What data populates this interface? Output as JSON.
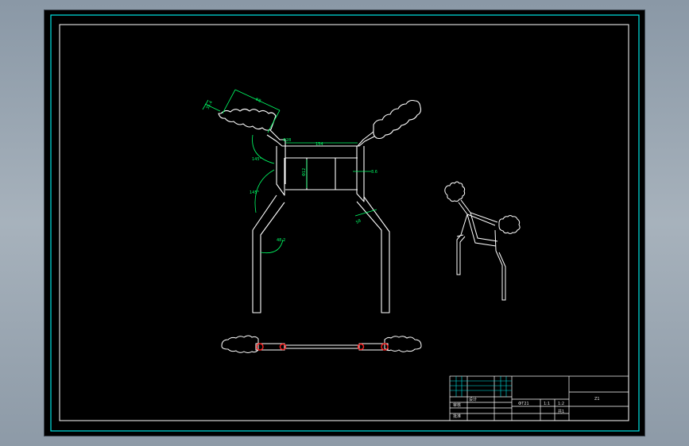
{
  "colors": {
    "sheet_background": "#000000",
    "border_cyan": "#00e5e5",
    "geometry_white": "#ffffff",
    "dimension_green": "#00ff66",
    "dimension_cyan": "#00d8ff",
    "weld_red": "#ff2020"
  },
  "dimensions": {
    "grip_length": "Φ8",
    "grip_width": "35.4",
    "top_span": "154",
    "tube_angle_top": "Φ28",
    "bend_angle_1": "145°",
    "bend_angle_2": "145°",
    "bend_angle_3": "48.2",
    "center_height": "Φ12",
    "wall_thickness": "3.6",
    "side_offset": "58"
  },
  "title_block": {
    "drawing_number": "Z1",
    "material": "ФТ21",
    "scale": "1:1",
    "sheet": "1:2",
    "designed": "设计",
    "checked": "审核",
    "approved": "批准",
    "count": "共1"
  },
  "icons": {
    "grip": "corrugated-grip-icon",
    "weld_ring": "weld-ring-icon"
  }
}
